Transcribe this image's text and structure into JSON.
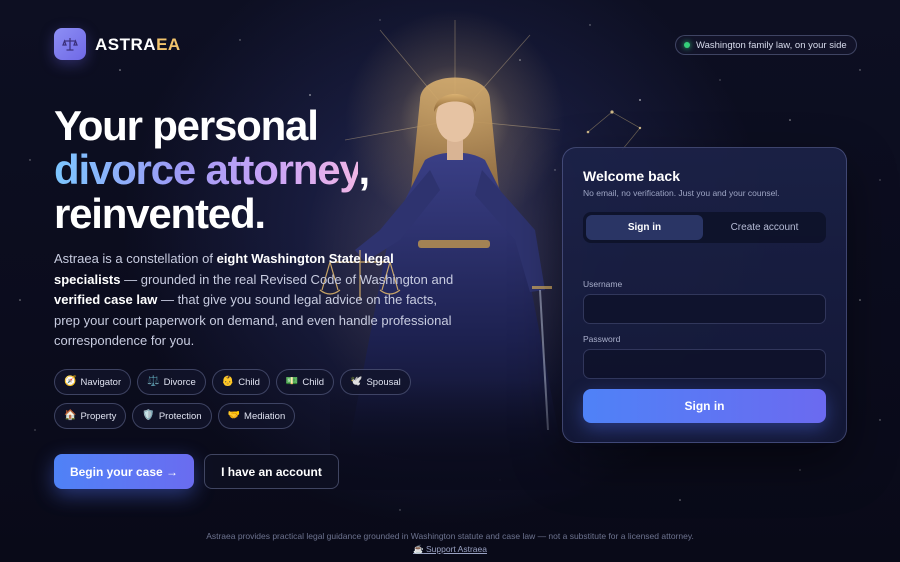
{
  "header": {
    "brand_main": "ASTRA",
    "brand_accent": "EA",
    "status_text": "Washington family law, on your side"
  },
  "hero": {
    "title_line1": "Your personal",
    "title_line2_gradient": "divorce attorney",
    "title_line2_suffix": ",",
    "title_line3": "reinvented.",
    "body": {
      "p1": "Astraea is a constellation of ",
      "b1": "eight Washington State legal specialists",
      "p2": " — grounded in the real Revised Code of Washington and ",
      "b2": "verified case law",
      "p3": " — that give you sound legal advice on the facts, prep your court paperwork on demand, and even handle professional correspondence for you."
    }
  },
  "chips": [
    {
      "icon": "🧭",
      "icon_name": "compass-icon",
      "label": "Navigator"
    },
    {
      "icon": "⚖️",
      "icon_name": "scales-icon",
      "label": "Divorce"
    },
    {
      "icon": "👶",
      "icon_name": "baby-icon",
      "label": "Child"
    },
    {
      "icon": "💵",
      "icon_name": "money-icon",
      "label": "Child"
    },
    {
      "icon": "🕊️",
      "icon_name": "dove-icon",
      "label": "Spousal"
    },
    {
      "icon": "🏠",
      "icon_name": "house-icon",
      "label": "Property"
    },
    {
      "icon": "🛡️",
      "icon_name": "shield-icon",
      "label": "Protection"
    },
    {
      "icon": "🤝",
      "icon_name": "handshake-icon",
      "label": "Mediation"
    }
  ],
  "cta": {
    "primary": "Begin your case →",
    "secondary": "I have an account"
  },
  "login": {
    "title": "Welcome back",
    "subtitle": "No email, no verification. Just you and your counsel.",
    "tab_signin": "Sign in",
    "tab_create": "Create account",
    "username_label": "Username",
    "username_value": "",
    "password_label": "Password",
    "password_value": "",
    "submit": "Sign in"
  },
  "footer": {
    "disclaimer": "Astraea provides practical legal guidance grounded in Washington statute and case law — not a substitute for a licensed attorney.",
    "support_icon": "☕",
    "support_label": "Support Astraea"
  },
  "colors": {
    "background": "#0b0c1d",
    "accent": "#5b78f4",
    "brand_accent": "#f1c36c",
    "status_dot": "#35d07a"
  }
}
